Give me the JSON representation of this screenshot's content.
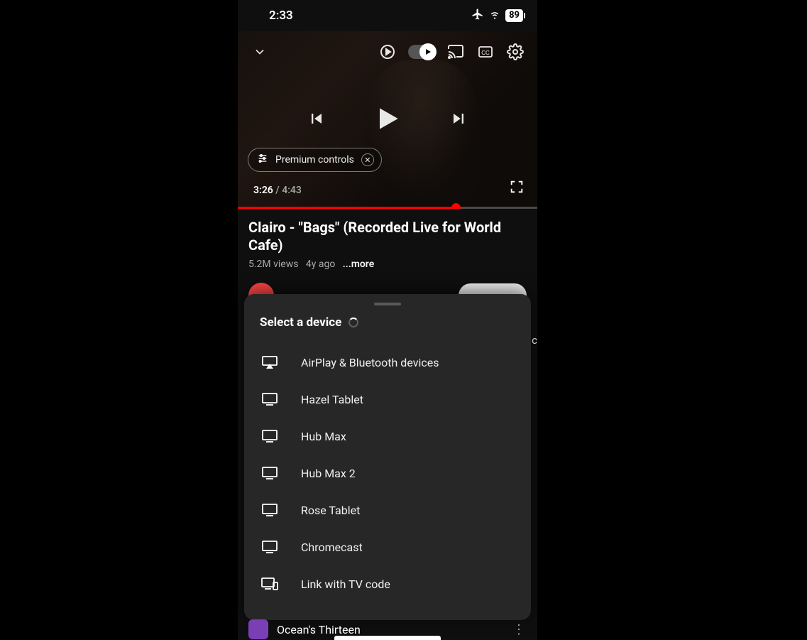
{
  "status": {
    "time": "2:33",
    "battery": "89"
  },
  "player": {
    "premium_label": "Premium controls",
    "current_time": "3:26",
    "duration": "4:43",
    "progress_percent": 73
  },
  "video": {
    "title": "Clairo - \"Bags\" (Recorded Live for World Cafe)",
    "views": "5.2M views",
    "age": "4y ago",
    "more_label": "...more"
  },
  "sheet": {
    "title": "Select a device",
    "devices": [
      {
        "label": "AirPlay & Bluetooth devices",
        "icon": "airplay"
      },
      {
        "label": "Hazel Tablet",
        "icon": "tv"
      },
      {
        "label": "Hub Max",
        "icon": "tv"
      },
      {
        "label": "Hub Max 2",
        "icon": "tv"
      },
      {
        "label": "Rose Tablet",
        "icon": "tv"
      },
      {
        "label": "Chromecast",
        "icon": "tv"
      },
      {
        "label": "Link with TV code",
        "icon": "tvcode"
      }
    ]
  },
  "next": {
    "title": "Ocean's Thirteen"
  },
  "edge_letter": "c"
}
